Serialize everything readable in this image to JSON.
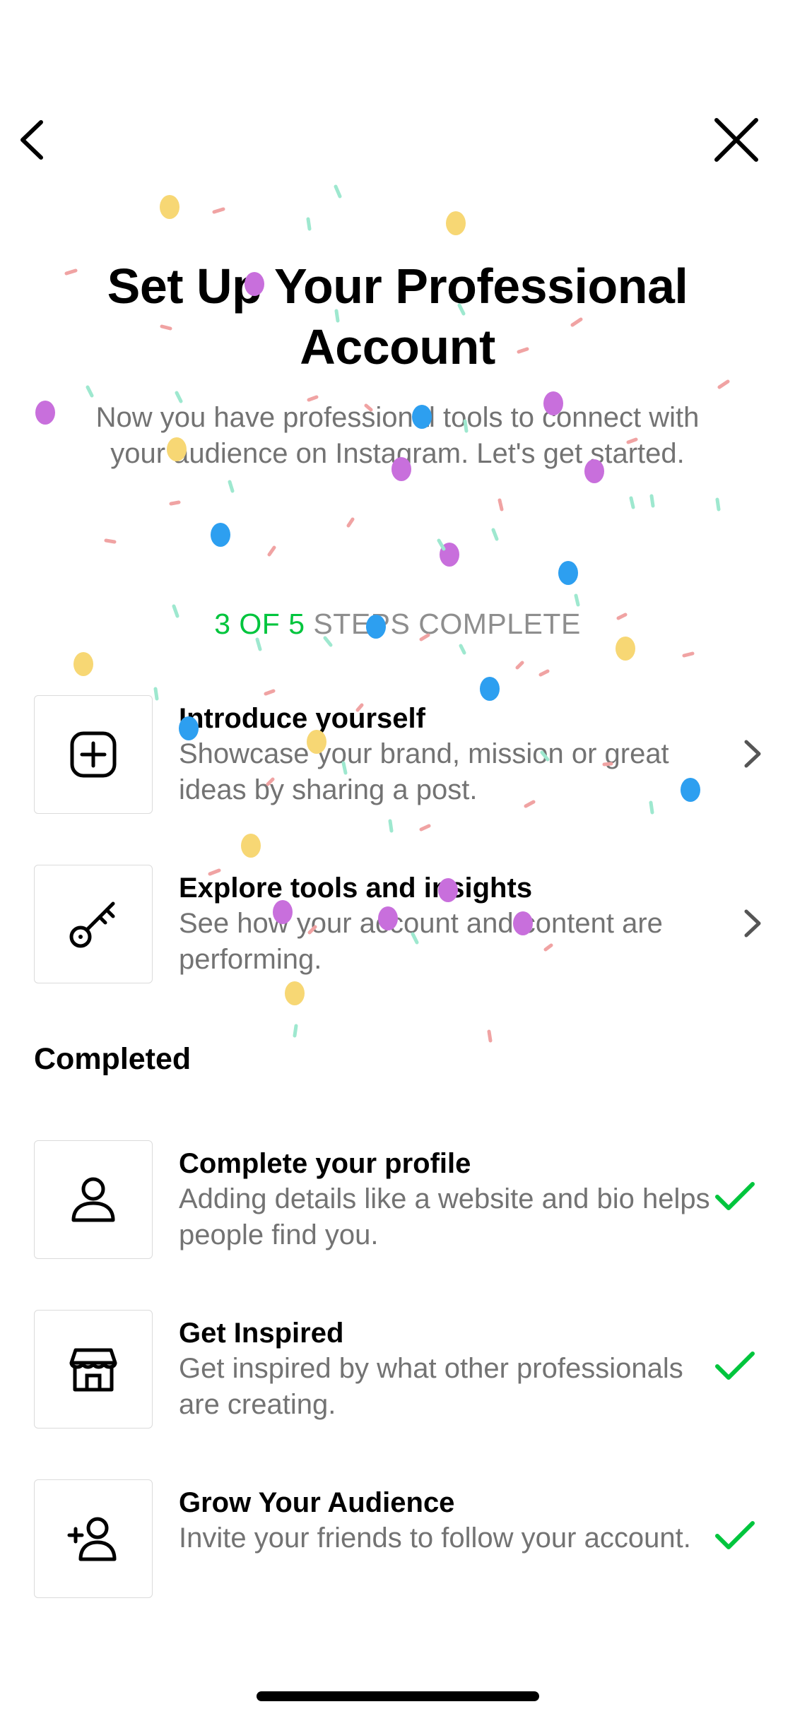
{
  "header": {
    "back_icon": "chevron-left-icon",
    "close_icon": "close-icon"
  },
  "title": "Set Up Your Professional Account",
  "subtitle": "Now you have professional tools to connect with your audience on Instagram. Let's get started.",
  "progress": {
    "done_text": "3 OF 5",
    "rest_text": " STEPS COMPLETE",
    "completed": 3,
    "total": 5
  },
  "todo": [
    {
      "icon": "add-post-icon",
      "title": "Introduce yourself",
      "description": "Showcase your brand, mission or great ideas by sharing a post."
    },
    {
      "icon": "key-icon",
      "title": "Explore tools and insights",
      "description": "See how your account and content are performing."
    }
  ],
  "completed_section": {
    "heading": "Completed",
    "items": [
      {
        "icon": "profile-icon",
        "title": "Complete your profile",
        "description": "Adding details like a website and bio helps people find you."
      },
      {
        "icon": "store-icon",
        "title": "Get Inspired",
        "description": "Get inspired by what other professionals are creating."
      },
      {
        "icon": "add-follower-icon",
        "title": "Grow Your Audience",
        "description": "Invite your friends to follow your account."
      }
    ]
  },
  "colors": {
    "accent_green": "#00c53d",
    "secondary_text": "#737373",
    "confetti_yellow": "#f7d774",
    "confetti_purple": "#c86fdc",
    "confetti_blue": "#2d9ff0",
    "confetti_pink": "#f0a3a3",
    "confetti_mint": "#9ee8cf"
  }
}
